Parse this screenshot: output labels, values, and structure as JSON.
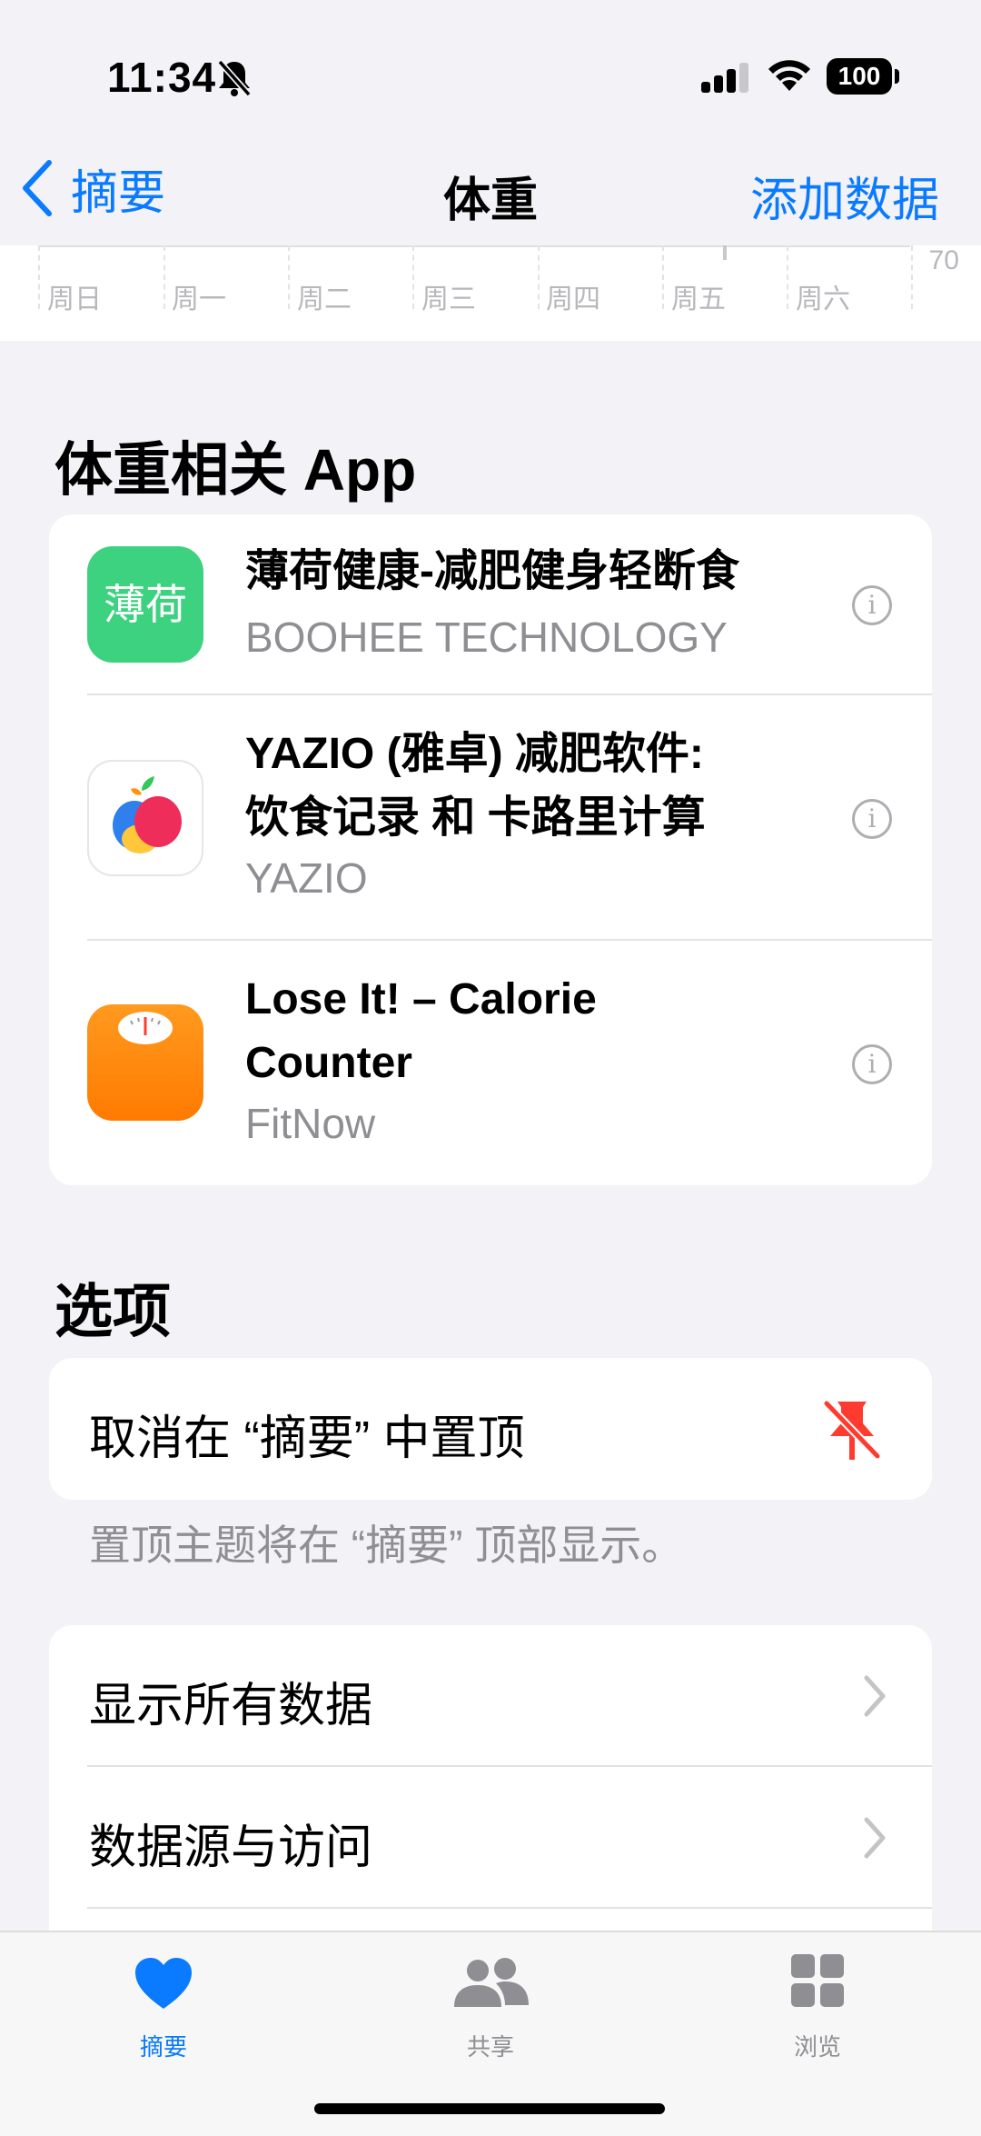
{
  "status": {
    "time": "11:34",
    "battery": "100"
  },
  "nav": {
    "back_label": "摘要",
    "title": "体重",
    "action_label": "添加数据"
  },
  "chart_strip": {
    "days": [
      "周日",
      "周一",
      "周二",
      "周三",
      "周四",
      "周五",
      "周六"
    ],
    "y_label": "70"
  },
  "apps_section": {
    "title": "体重相关 App",
    "items": [
      {
        "name": "薄荷健康-减肥健身轻断食",
        "developer": "BOOHEE TECHNOLOGY",
        "icon_text": "薄荷",
        "icon": "boohee-app-icon"
      },
      {
        "name": "YAZIO (雅卓) 减肥软件:\n饮食记录 和 卡路里计算",
        "developer": "YAZIO",
        "icon": "yazio-app-icon"
      },
      {
        "name": "Lose It! – Calorie\nCounter",
        "developer": "FitNow",
        "icon": "loseit-app-icon"
      }
    ]
  },
  "options_section": {
    "title": "选项",
    "unpin_label": "取消在 “摘要” 中置顶",
    "footnote": "置顶主题将在 “摘要” 顶部显示。",
    "show_all_label": "显示所有数据",
    "sources_label": "数据源与访问"
  },
  "tab_bar": {
    "tabs": [
      {
        "label": "摘要",
        "icon": "heart-icon",
        "active": true
      },
      {
        "label": "共享",
        "icon": "people-icon",
        "active": false
      },
      {
        "label": "浏览",
        "icon": "grid-icon",
        "active": false
      }
    ]
  },
  "colors": {
    "accent": "#0a7aff",
    "pin": "#ff3b30",
    "boohee_green": "#3dd27f",
    "loseit_orange": "#ff8a00"
  }
}
